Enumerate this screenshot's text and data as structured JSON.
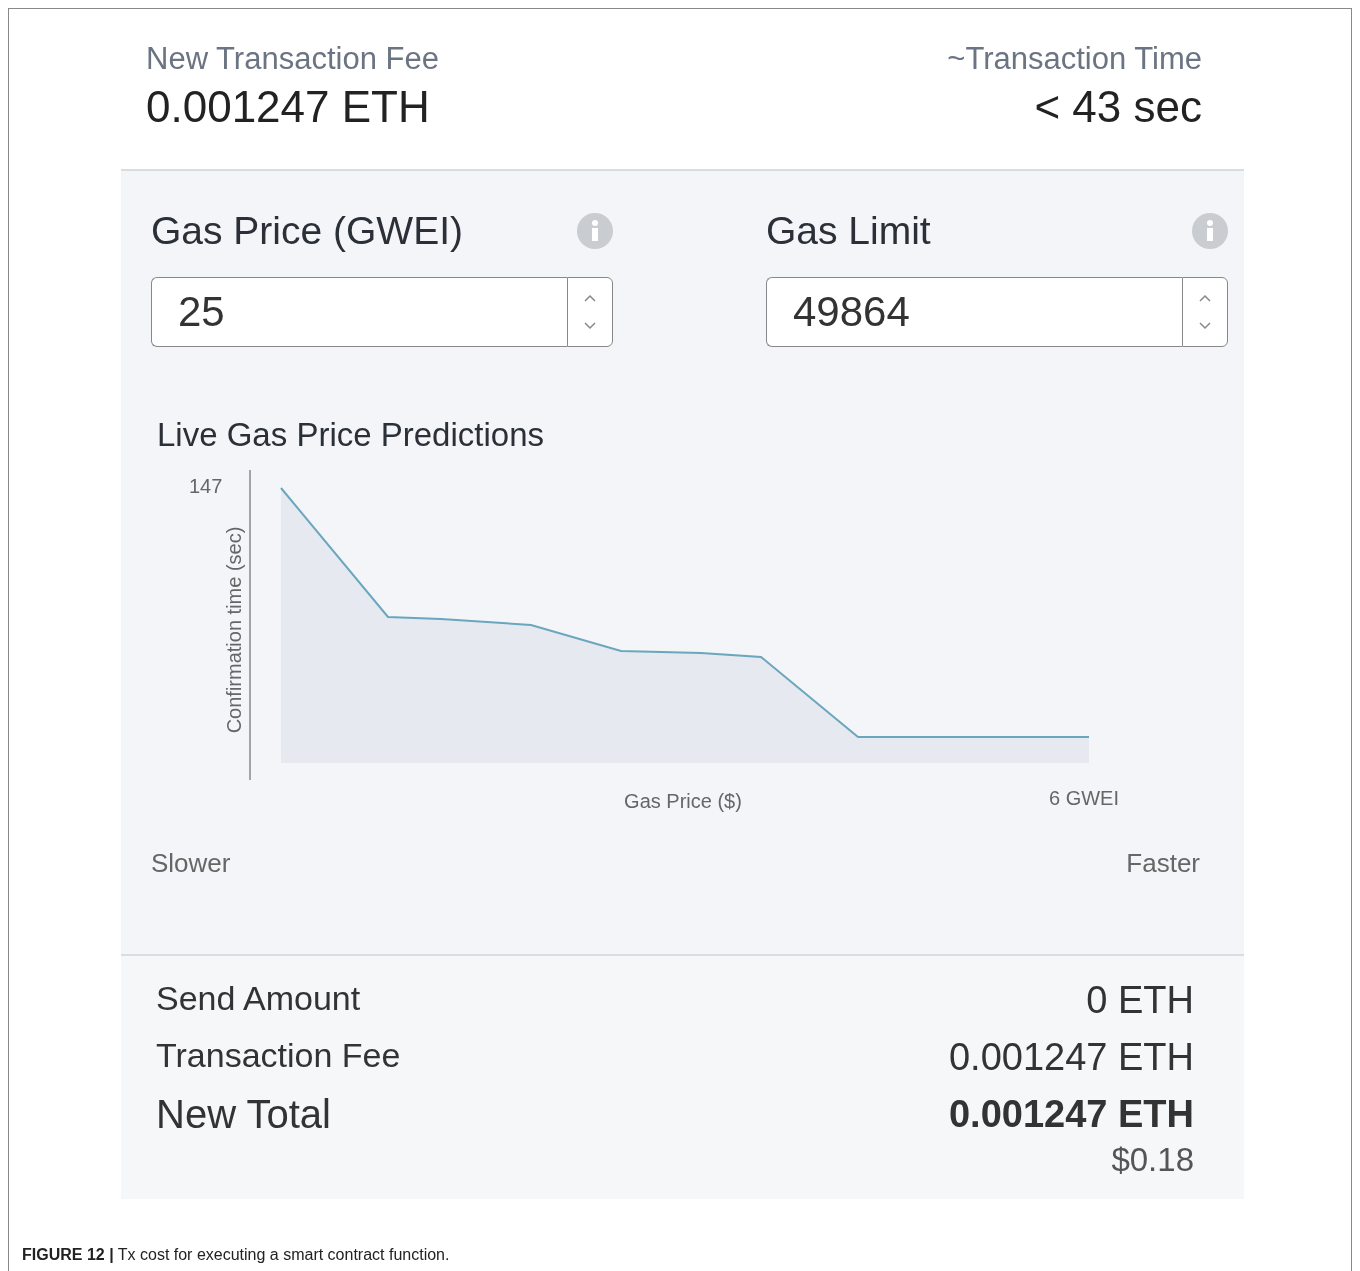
{
  "header": {
    "fee_label": "New Transaction Fee",
    "fee_value": "0.001247 ETH",
    "time_label": "~Transaction Time",
    "time_value": "< 43 sec"
  },
  "fields": [
    {
      "label": "Gas Price (GWEI)",
      "value": "25"
    },
    {
      "label": "Gas Limit",
      "value": "49864"
    }
  ],
  "chart": {
    "title": "Live Gas Price Predictions",
    "y_tick": "147",
    "y_axis_label": "Confirmation time (sec)",
    "x_axis_label": "Gas Price ($)",
    "x_end_label": "6 GWEI"
  },
  "speed_labels": {
    "left": "Slower",
    "right": "Faster"
  },
  "summary": [
    {
      "kind": "plain",
      "label": "Send Amount",
      "value": "0 ETH"
    },
    {
      "kind": "plain",
      "label": "Transaction Fee",
      "value": "0.001247 ETH"
    },
    {
      "kind": "total",
      "label": "New Total",
      "value": "0.001247 ETH",
      "subvalue": "$0.18"
    }
  ],
  "caption": "**FIGURE 12 |** Tx cost for executing a smart contract function."
}
